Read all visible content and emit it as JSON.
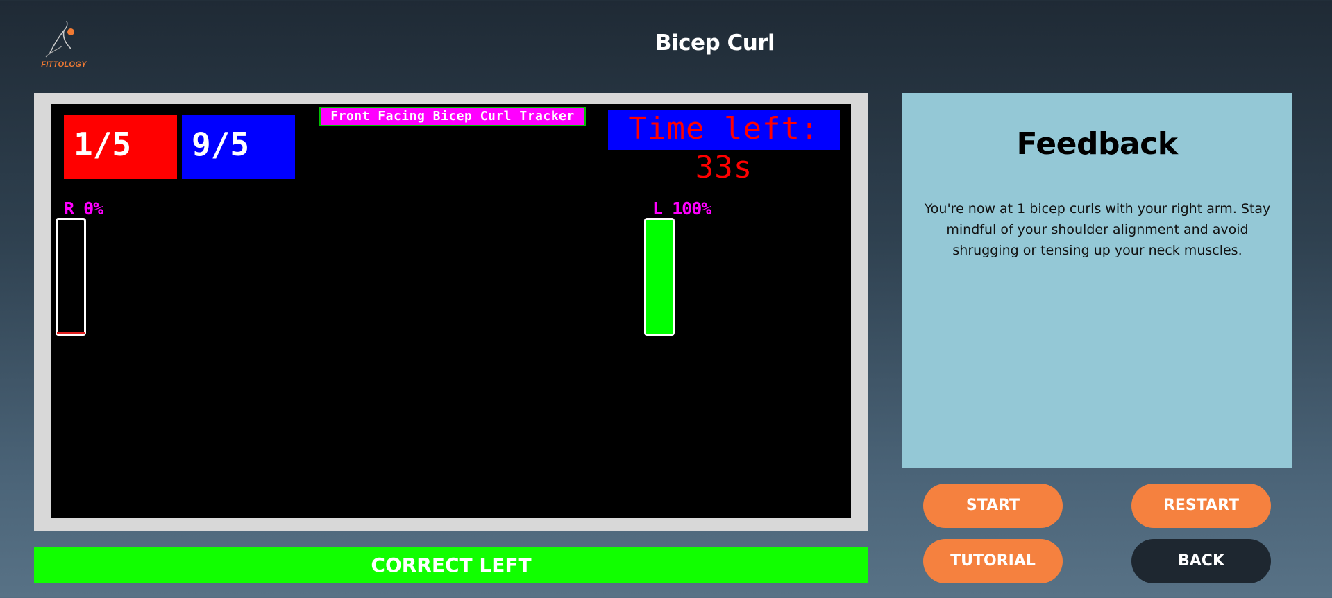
{
  "header": {
    "logo_text": "FITTOLOGY",
    "title": "Bicep Curl"
  },
  "video": {
    "right_count": "1/5",
    "left_count": "9/5",
    "tracker_title": "Front Facing Bicep Curl Tracker",
    "timer": "Time left: 33s",
    "right_bar": {
      "label": "R 0%",
      "progress": 0
    },
    "left_bar": {
      "label": "L 100%",
      "progress": 1.0
    },
    "colors": {
      "right_count_bg": "#ff0000",
      "left_count_bg": "#0000ff",
      "tracker_bg": "#ff00ff",
      "bar_fill": "#00ff00",
      "label_color": "#ff00ff"
    }
  },
  "status": {
    "text": "CORRECT LEFT",
    "color": "#11ff00"
  },
  "feedback": {
    "title": "Feedback",
    "text": "You're now at 1 bicep curls with your right arm. Stay mindful of your shoulder alignment and avoid shrugging or tensing up your neck muscles."
  },
  "buttons": {
    "start": "START",
    "restart": "RESTART",
    "tutorial": "TUTORIAL",
    "back": "BACK"
  },
  "theme": {
    "accent": "#f5813f",
    "dark_button": "#1e2730",
    "panel_bg": "#94c8d6"
  }
}
